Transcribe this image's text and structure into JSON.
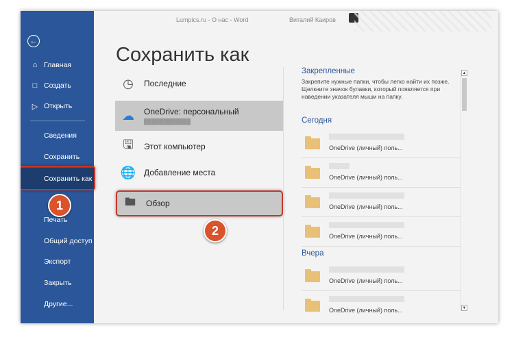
{
  "window": {
    "doc_title": "Lumpics.ru - О нас - Word",
    "user_name": "Виталий Каиров"
  },
  "nav": {
    "back_icon": "back-arrow-icon",
    "items": [
      {
        "label": "Главная",
        "icon": "home-icon"
      },
      {
        "label": "Создать",
        "icon": "new-doc-icon"
      },
      {
        "label": "Открыть",
        "icon": "folder-open-icon"
      },
      {
        "label": "Сведения"
      },
      {
        "label": "Сохранить"
      },
      {
        "label": "Сохранить как"
      },
      {
        "label": "Печать"
      },
      {
        "label": "Общий доступ"
      },
      {
        "label": "Экспорт"
      },
      {
        "label": "Закрыть"
      },
      {
        "label": "Другие..."
      }
    ],
    "accent": "#2b579a"
  },
  "main": {
    "title": "Сохранить как",
    "locations": [
      {
        "label": "Последние",
        "icon": "clock-icon"
      },
      {
        "label": "OneDrive: персональный",
        "icon": "cloud-icon"
      },
      {
        "label": "Этот компьютер",
        "icon": "computer-icon"
      },
      {
        "label": "Добавление места",
        "icon": "add-place-icon"
      },
      {
        "label": "Обзор",
        "icon": "folder-icon"
      }
    ],
    "badge1": "1",
    "badge2": "2"
  },
  "right": {
    "pinned_title": "Закрепленные",
    "pinned_desc": "Закрепите нужные папки, чтобы легко найти их позже. Щелкните значок булавки, который появляется при наведении указателя мыши на папку.",
    "today": "Сегодня",
    "yesterday": "Вчера",
    "files_today": [
      {
        "location": "OneDrive (личный) поль..."
      },
      {
        "location": "OneDrive (личный) поль..."
      },
      {
        "location": "OneDrive (личный) поль..."
      },
      {
        "location": "OneDrive (личный) поль..."
      }
    ],
    "files_yesterday": [
      {
        "location": "OneDrive (личный) поль..."
      },
      {
        "location": "OneDrive (личный) поль..."
      }
    ]
  },
  "colors": {
    "highlight": "#c0392b",
    "badge": "#d9532c",
    "folder": "#e8c077"
  }
}
